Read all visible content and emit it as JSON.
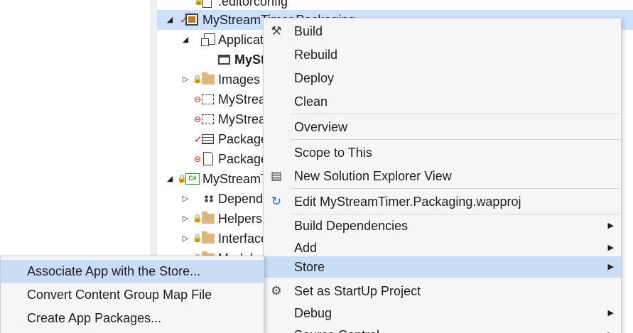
{
  "tree": {
    "rows": [
      {
        "label": ".editorconfig",
        "marker": "lock",
        "icon": "doc-icon"
      },
      {
        "label": "MyStreamTimer.Packaging",
        "marker": "check",
        "icon": "package-project-icon"
      },
      {
        "label": "Applications",
        "icon": "application-folder-icon"
      },
      {
        "label": "MyStreamTimer",
        "icon": "window-icon"
      },
      {
        "label": "Images",
        "marker": "lock",
        "icon": "folder-icon"
      },
      {
        "label": "MyStreamTimer.Packaging_StoreKey.pfx",
        "marker": "dot",
        "icon": "certificate-icon"
      },
      {
        "label": "MyStreamTimer.Packaging_TemporaryKey.pfx",
        "marker": "dot",
        "icon": "certificate-icon"
      },
      {
        "label": "Package.appxmanifest",
        "marker": "check",
        "icon": "manifest-icon"
      },
      {
        "label": "Package.StoreAssociation.xml",
        "marker": "dot",
        "icon": "xml-file-icon"
      },
      {
        "label": "MyStreamTimer.Core",
        "marker": "lock",
        "icon": "csharp-project-icon"
      },
      {
        "label": "Dependencies",
        "icon": "dependencies-icon"
      },
      {
        "label": "Helpers",
        "marker": "lock",
        "icon": "folder-icon"
      },
      {
        "label": "Interfaces",
        "marker": "lock",
        "icon": "folder-icon"
      },
      {
        "label": "Models",
        "marker": "lock",
        "icon": "folder-icon"
      }
    ]
  },
  "context_menu": {
    "items": [
      {
        "label": "Build",
        "icon": "build-icon"
      },
      {
        "label": "Rebuild"
      },
      {
        "label": "Deploy"
      },
      {
        "label": "Clean"
      },
      {
        "label": "Overview"
      },
      {
        "label": "Scope to This"
      },
      {
        "label": "New Solution Explorer View",
        "icon": "solution-explorer-icon"
      },
      {
        "label": "Edit MyStreamTimer.Packaging.wapproj",
        "icon": "refresh-icon"
      },
      {
        "label": "Build Dependencies",
        "submenu": true
      },
      {
        "label": "Add",
        "submenu": true
      },
      {
        "label": "Store",
        "submenu": true,
        "highlighted": true
      },
      {
        "label": "Set as StartUp Project",
        "icon": "gear-icon"
      },
      {
        "label": "Debug",
        "submenu": true
      },
      {
        "label": "Source Control",
        "submenu": true
      }
    ]
  },
  "store_submenu": {
    "items": [
      {
        "label": "Associate App with the Store...",
        "highlighted": true
      },
      {
        "label": "Convert Content Group Map File"
      },
      {
        "label": "Create App Packages..."
      }
    ]
  },
  "colors": {
    "selection": "#cce0ff",
    "menu_highlight": "#c9def5",
    "menu_background": "#f6f6f6",
    "folder": "#dcb67a",
    "lock": "#1c97ea",
    "red_marker": "#e51400"
  },
  "glyphs": {
    "expanded": "◢",
    "collapsed": "▷",
    "submenu_arrow": "▶",
    "lock": "🔒",
    "dot": "⊖",
    "check": "✓",
    "build": "⚒",
    "refresh": "↻",
    "gear": "⚙",
    "explorer": "▤"
  }
}
